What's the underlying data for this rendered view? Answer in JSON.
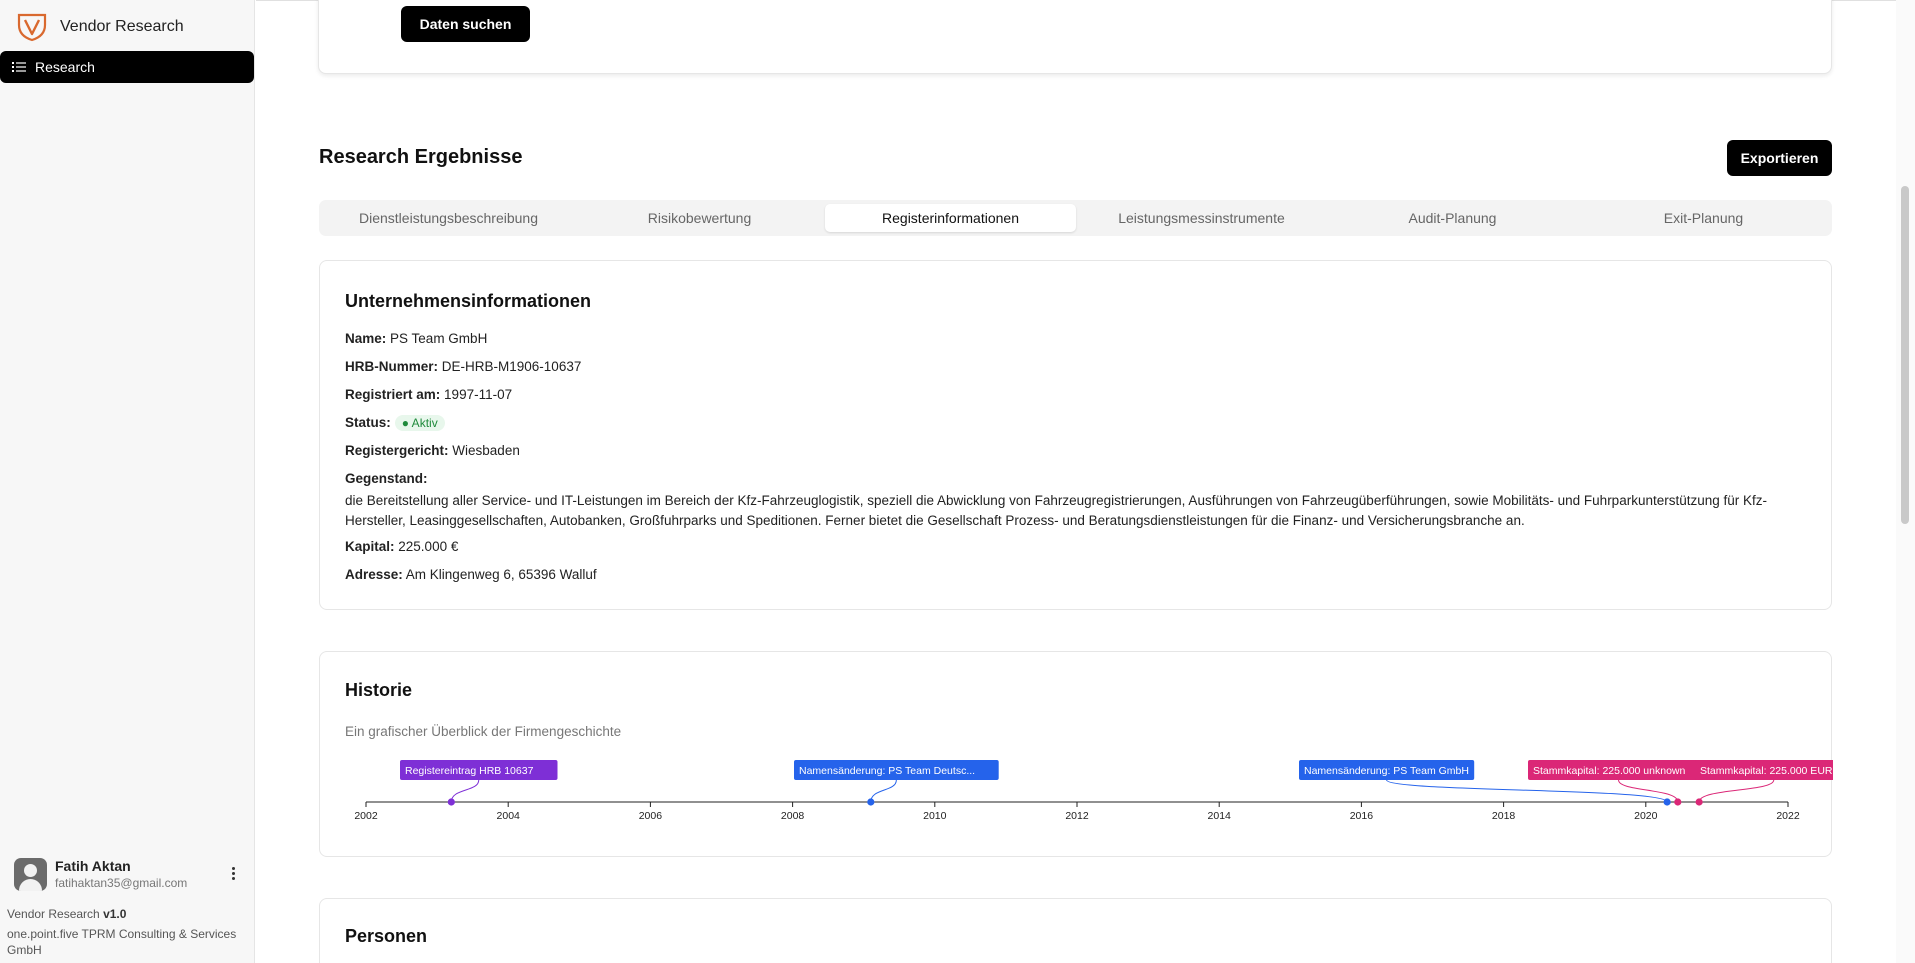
{
  "app": {
    "brand_name": "Vendor Research",
    "brand_color": "#d9692f"
  },
  "sidebar": {
    "items": [
      {
        "label": "Research",
        "icon": "list-icon",
        "active": true
      }
    ]
  },
  "user": {
    "name": "Fatih Aktan",
    "email": "fatihaktan35@gmail.com"
  },
  "footer": {
    "version_prefix": "Vendor Research ",
    "version": "v1.0",
    "company": "one.point.five TPRM Consulting & Services GmbH"
  },
  "search": {
    "button_label": "Daten suchen"
  },
  "results": {
    "title": "Research Ergebnisse",
    "export_label": "Exportieren",
    "tabs": [
      {
        "label": "Dienstleistungsbeschreibung",
        "active": false
      },
      {
        "label": "Risikobewertung",
        "active": false
      },
      {
        "label": "Registerinformationen",
        "active": true
      },
      {
        "label": "Leistungsmessinstrumente",
        "active": false
      },
      {
        "label": "Audit-Planung",
        "active": false
      },
      {
        "label": "Exit-Planung",
        "active": false
      }
    ]
  },
  "company_info": {
    "title": "Unternehmensinformationen",
    "name_label": "Name:",
    "name": "PS Team GmbH",
    "hrb_label": "HRB-Nummer:",
    "hrb": "DE-HRB-M1906-10637",
    "registered_label": "Registriert am:",
    "registered": "1997-11-07",
    "status_label": "Status:",
    "status": "● Aktiv",
    "court_label": "Registergericht:",
    "court": "Wiesbaden",
    "purpose_label": "Gegenstand:",
    "purpose": "die Bereitstellung aller Service- und IT-Leistungen im Bereich der Kfz-Fahrzeuglogistik, speziell die Abwicklung von Fahrzeugregistrierungen, Ausführungen von Fahrzeugüberführungen, sowie Mobilitäts- und Fuhrparkunterstützung für Kfz-Hersteller, Leasinggesellschaften, Autobanken, Großfuhrparks und Speditionen. Ferner bietet die Gesellschaft Prozess- und Beratungsdienstleistungen für die Finanz- und Versicherungsbranche an.",
    "capital_label": "Kapital:",
    "capital": "225.000 €",
    "address_label": "Adresse:",
    "address": "Am Klingenweg 6, 65396 Walluf"
  },
  "history": {
    "title": "Historie",
    "subtitle": "Ein grafischer Überblick der Firmengeschichte",
    "chart_data": {
      "type": "scatter",
      "x_range": [
        2002,
        2022
      ],
      "x_ticks": [
        "2002",
        "2004",
        "2006",
        "2008",
        "2010",
        "2012",
        "2014",
        "2016",
        "2018",
        "2020",
        "2022"
      ],
      "events": [
        {
          "year": 2003.2,
          "label": "Registereintrag HRB 10637",
          "color": "#7e2fd6"
        },
        {
          "year": 2009.1,
          "label": "Namensänderung: PS Team Deutsc...",
          "color": "#2563eb"
        },
        {
          "year": 2020.3,
          "label": "Namensänderung: PS Team GmbH",
          "color": "#2563eb"
        },
        {
          "year": 2020.45,
          "label": "Stammkapital: 225.000 unknown",
          "color": "#db2777"
        },
        {
          "year": 2020.75,
          "label": "Stammkapital: 225.000 EUR",
          "color": "#db2777"
        }
      ]
    }
  },
  "persons": {
    "title": "Personen"
  }
}
